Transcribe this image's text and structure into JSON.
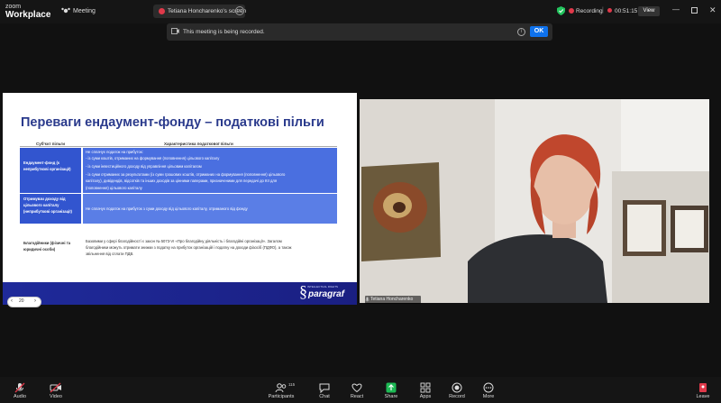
{
  "top": {
    "app_line1": "zoom",
    "app_line2": "Workplace",
    "meeting_label": "Meeting",
    "screen_share_label": "Tetiana Honcharenko's screen",
    "recording_label": "Recording",
    "timer": "00:51:15",
    "view_label": "View"
  },
  "banner": {
    "message": "This meeting is being recorded.",
    "ok_label": "OK"
  },
  "slide": {
    "title": "Переваги ендаумент-фонду – податкові пільги",
    "col1_header": "Суб'єкт пільги",
    "col2_header": "Характеристика податкової пільги",
    "rows": [
      {
        "subject": "Ендаумент-фонд (є неприбуткові організації)",
        "lines": [
          "Не сплачує податок на прибуток:",
          "- із суми коштів, отриманих на формування (поповнення) цільового капіталу",
          "- із суми інвестиційного доходу від управління цільовим капіталом",
          "- із суми отриманих за результатами (із суми грошових коштів, отриманих на формування (поповнення) цільового",
          "капіталу), дивідендів, відсотків та інших доходів за цінними паперами, призначеними для передачі до КІІ для",
          "(поповнення) цільового капіталу"
        ]
      },
      {
        "subject": "Отримувач доходу від цільового капіталу (неприбуткові організації)",
        "lines": [
          "Не сплачує податок на прибуток з суми доходу від цільового капіталу, отриманого від фонду"
        ]
      },
      {
        "subject": "Благодійники (фізичні та юридичні особи)",
        "lines": [
          "Базовими у сфері благодійності є закон № 5073-VI «Про благодійну діяльність і благодійні організації». Загалом",
          "благодійники можуть отримати знижки з податку на прибуток організацій і податку на доходи фізосіб (ПДФО), а також",
          "звільнення від сплати ПДВ."
        ]
      }
    ],
    "brand_sub": "INTELLECTUAL RIGHTS",
    "brand": "paragraf",
    "page_number": "20"
  },
  "video": {
    "participant_name": "Tetiana Honcharenko"
  },
  "toolbar": {
    "audio": "Audio",
    "video": "Video",
    "participants": "Participants",
    "participants_count": "115",
    "chat": "Chat",
    "react": "React",
    "share": "Share",
    "apps": "Apps",
    "record": "Record",
    "more": "More",
    "leave": "Leave"
  },
  "colors": {
    "accent": "#0e72ed",
    "share_green": "#1db954",
    "recording_red": "#e0394a",
    "slide_blue": "#3a5fd6",
    "slide_title": "#2a3a8c"
  }
}
